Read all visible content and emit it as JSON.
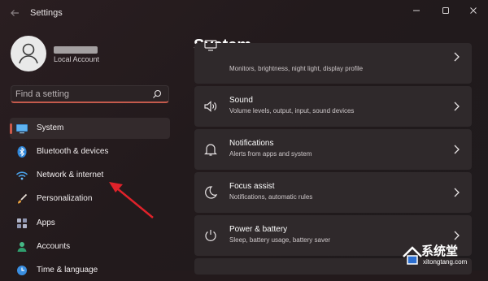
{
  "window": {
    "title": "Settings",
    "controls": {
      "minimize": "minimize-icon",
      "maximize": "maximize-icon",
      "close": "close-icon"
    }
  },
  "profile": {
    "name": "",
    "account_type": "Local Account"
  },
  "search": {
    "placeholder": "Find a setting"
  },
  "sidebar": {
    "items": [
      {
        "label": "System",
        "icon": "monitor-icon",
        "selected": true
      },
      {
        "label": "Bluetooth & devices",
        "icon": "bluetooth-icon"
      },
      {
        "label": "Network & internet",
        "icon": "wifi-icon"
      },
      {
        "label": "Personalization",
        "icon": "brush-icon"
      },
      {
        "label": "Apps",
        "icon": "apps-icon"
      },
      {
        "label": "Accounts",
        "icon": "person-icon"
      },
      {
        "label": "Time & language",
        "icon": "clock-icon"
      }
    ]
  },
  "main": {
    "title": "System",
    "cards": [
      {
        "title": "",
        "subtitle": "Monitors, brightness, night light, display profile",
        "icon": "display-icon"
      },
      {
        "title": "Sound",
        "subtitle": "Volume levels, output, input, sound devices",
        "icon": "speaker-icon"
      },
      {
        "title": "Notifications",
        "subtitle": "Alerts from apps and system",
        "icon": "bell-icon"
      },
      {
        "title": "Focus assist",
        "subtitle": "Notifications, automatic rules",
        "icon": "moon-icon"
      },
      {
        "title": "Power & battery",
        "subtitle": "Sleep, battery usage, battery saver",
        "icon": "power-icon"
      }
    ]
  },
  "watermark": {
    "text": "系统堂",
    "url": "xitongtang.com"
  },
  "colors": {
    "accent": "#cc5a4a",
    "arrow": "#e0222a",
    "card": "#2f292b",
    "background": "#231a1c"
  }
}
